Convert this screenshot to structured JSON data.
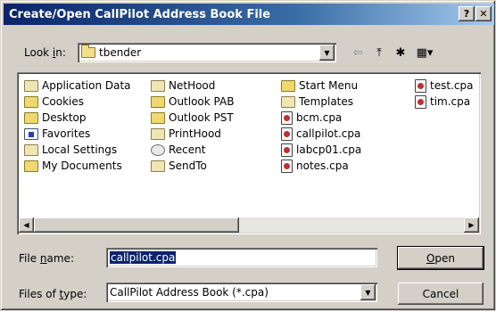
{
  "window": {
    "title": "Create/Open CallPilot Address Book File",
    "help_label": "?",
    "close_label": "✕"
  },
  "lookin": {
    "label_pre": "Look ",
    "label_hot": "i",
    "label_post": "n:",
    "value": "tbender"
  },
  "toolbar": {
    "back_glyph": "⇦",
    "up_glyph": "⤒",
    "newfolder_glyph": "✱",
    "views_glyph": "▦▾"
  },
  "files": {
    "col1": [
      {
        "label": "Application Data",
        "icon": "folder-icon"
      },
      {
        "label": "Cookies",
        "icon": "folder-icon"
      },
      {
        "label": "Desktop",
        "icon": "folder-icon"
      },
      {
        "label": "Favorites",
        "icon": "favorites-icon"
      },
      {
        "label": "Local Settings",
        "icon": "folder-icon"
      },
      {
        "label": "My Documents",
        "icon": "folder-icon"
      }
    ],
    "col2": [
      {
        "label": "NetHood",
        "icon": "folder-icon"
      },
      {
        "label": "Outlook PAB",
        "icon": "folder-icon"
      },
      {
        "label": "Outlook PST",
        "icon": "folder-icon"
      },
      {
        "label": "PrintHood",
        "icon": "folder-icon"
      },
      {
        "label": "Recent",
        "icon": "recent-icon"
      },
      {
        "label": "SendTo",
        "icon": "folder-icon"
      }
    ],
    "col3": [
      {
        "label": "Start Menu",
        "icon": "folder-icon"
      },
      {
        "label": "Templates",
        "icon": "folder-icon"
      },
      {
        "label": "bcm.cpa",
        "icon": "cpa-file-icon"
      },
      {
        "label": "callpilot.cpa",
        "icon": "cpa-file-icon"
      },
      {
        "label": "labcp01.cpa",
        "icon": "cpa-file-icon"
      },
      {
        "label": "notes.cpa",
        "icon": "cpa-file-icon"
      }
    ],
    "col4": [
      {
        "label": "test.cpa",
        "icon": "cpa-file-icon"
      },
      {
        "label": "tim.cpa",
        "icon": "cpa-file-icon"
      }
    ]
  },
  "filename": {
    "label_pre": "File ",
    "label_hot": "n",
    "label_post": "ame:",
    "value": "callpilot.cpa"
  },
  "filetype": {
    "label_pre": "Files of ",
    "label_hot": "t",
    "label_post": "ype:",
    "value": "CallPilot Address Book (*.cpa)"
  },
  "buttons": {
    "open_hot": "O",
    "open_rest": "pen",
    "cancel": "Cancel"
  }
}
